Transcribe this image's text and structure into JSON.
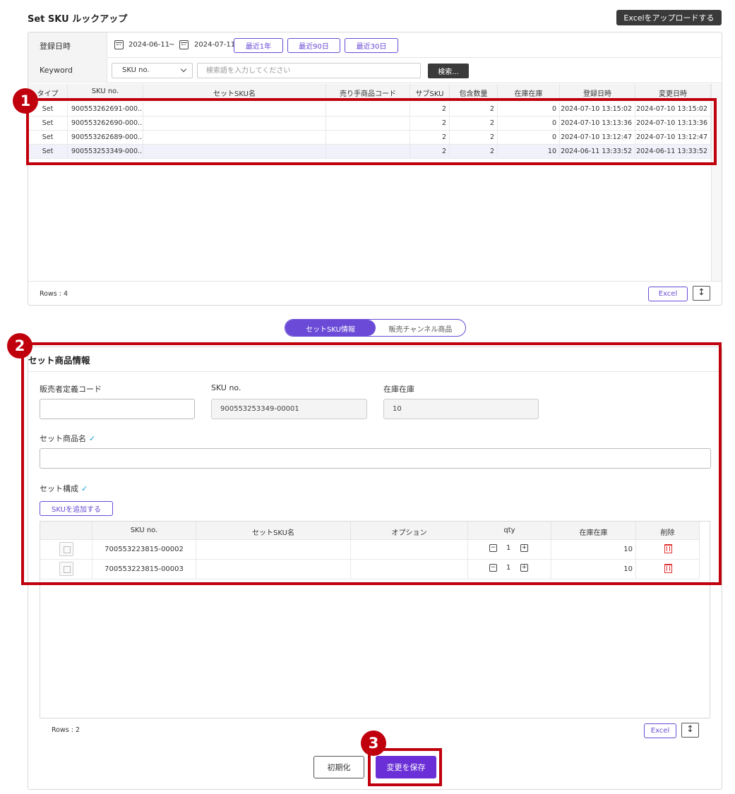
{
  "page": {
    "title": "Set SKU ルックアップ",
    "upload_label": "Excelをアップロードする"
  },
  "filters": {
    "date_label": "登録日時",
    "date_from": "2024-06-11",
    "date_sep": "~",
    "date_to": "2024-07-11",
    "presets": [
      "最近1年",
      "最近90日",
      "最近30日"
    ],
    "keyword_label": "Keyword",
    "keyword_select": "SKU no.",
    "keyword_placeholder": "検索語を入力してください",
    "search_label": "検索..."
  },
  "grid": {
    "columns": [
      "タイプ",
      "SKU no.",
      "セットSKU名",
      "売り手商品コード",
      "サブSKU",
      "包含数量",
      "在庫在庫",
      "登録日時",
      "変更日時"
    ],
    "rows": [
      [
        "Set",
        "900553262691-000...",
        "",
        "",
        "2",
        "2",
        "0",
        "2024-07-10 13:15:02",
        "2024-07-10 13:15:02"
      ],
      [
        "Set",
        "900553262690-000...",
        "",
        "",
        "2",
        "2",
        "0",
        "2024-07-10 13:13:36",
        "2024-07-10 13:13:36"
      ],
      [
        "Set",
        "900553262689-000...",
        "",
        "",
        "2",
        "2",
        "0",
        "2024-07-10 13:12:47",
        "2024-07-10 13:12:47"
      ],
      [
        "Set",
        "900553253349-000...",
        "",
        "",
        "2",
        "2",
        "10",
        "2024-06-11 13:33:52",
        "2024-06-11 13:33:52"
      ]
    ],
    "rows_count": "Rows : 4",
    "excel_label": "Excel"
  },
  "tabs": [
    "セットSKU情報",
    "販売チャンネル商品"
  ],
  "detail": {
    "title": "セット商品情報",
    "seller_code_label": "販売者定義コード",
    "seller_code_value": "",
    "sku_label": "SKU no.",
    "sku_value": "900553253349-00001",
    "stock_label": "在庫在庫",
    "stock_value": "10",
    "name_label": "セット商品名",
    "name_value": "",
    "composition_label": "セット構成",
    "check_mark": "✓",
    "add_sku_label": "SKUを追加する",
    "columns": [
      "",
      "SKU no.",
      "セットSKU名",
      "オプション",
      "qty",
      "在庫在庫",
      "削除"
    ],
    "items": [
      {
        "sku": "700553223815-00002",
        "name": "",
        "option": "",
        "qty": "1",
        "stock": "10"
      },
      {
        "sku": "700553223815-00003",
        "name": "",
        "option": "",
        "qty": "1",
        "stock": "10"
      }
    ],
    "rows_count": "Rows : 2",
    "excel_label": "Excel"
  },
  "actions": {
    "reset_label": "初期化",
    "save_label": "変更を保存"
  },
  "annotations": [
    "1",
    "2",
    "3"
  ],
  "colors": {
    "accent": "#6a4ad6",
    "highlight": "#c0000c",
    "dark_button": "#3a3a3a",
    "delete": "#e03030"
  }
}
